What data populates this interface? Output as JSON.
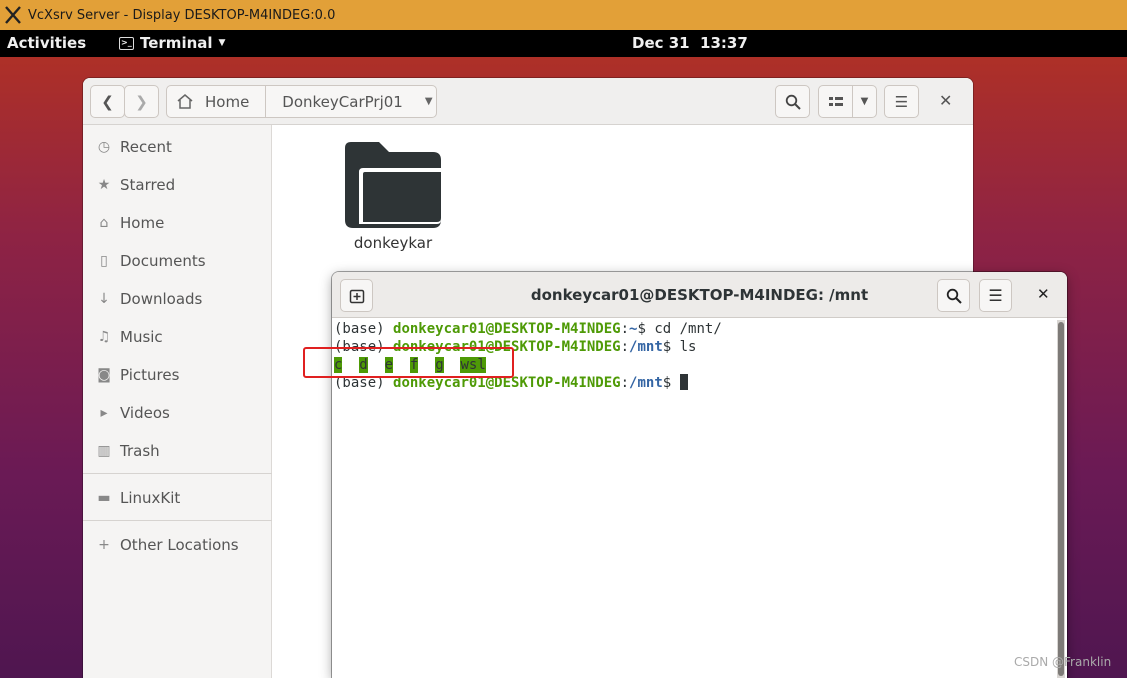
{
  "host": {
    "title": "VcXsrv Server - Display DESKTOP-M4INDEG:0.0"
  },
  "topbar": {
    "activities": "Activities",
    "app": "Terminal",
    "clock": "Dec 31  13:37"
  },
  "files": {
    "breadcrumb": {
      "home": "Home",
      "current": "DonkeyCarPrj01"
    },
    "sidebar": {
      "items": [
        {
          "label": "Recent",
          "icon": "clock-icon"
        },
        {
          "label": "Starred",
          "icon": "star-icon"
        },
        {
          "label": "Home",
          "icon": "home-icon"
        },
        {
          "label": "Documents",
          "icon": "document-icon"
        },
        {
          "label": "Downloads",
          "icon": "download-icon"
        },
        {
          "label": "Music",
          "icon": "music-icon"
        },
        {
          "label": "Pictures",
          "icon": "camera-icon"
        },
        {
          "label": "Videos",
          "icon": "video-icon"
        },
        {
          "label": "Trash",
          "icon": "trash-icon"
        }
      ],
      "devices": [
        {
          "label": "LinuxKit",
          "icon": "drive-icon"
        }
      ],
      "other": {
        "label": "Other Locations",
        "icon": "plus-icon"
      }
    },
    "content": {
      "folder_name": "donkeykar"
    }
  },
  "terminal": {
    "title": "donkeycar01@DESKTOP-M4INDEG: /mnt",
    "lines": {
      "l1_prefix": "(base) ",
      "l1_user": "donkeycar01@DESKTOP-M4INDEG",
      "l1_colon": ":",
      "l1_path": "~",
      "l1_cmd": "$ cd /mnt/",
      "l2_prefix": "(base) ",
      "l2_user": "donkeycar01@DESKTOP-M4INDEG",
      "l2_colon": ":",
      "l2_path": "/mnt",
      "l2_cmd": "$ ls",
      "l3_dirs": [
        "c",
        "d",
        "e",
        "f",
        "g"
      ],
      "l3_wsl": "wsl",
      "l4_prefix": "(base) ",
      "l4_user": "donkeycar01@DESKTOP-M4INDEG",
      "l4_colon": ":",
      "l4_path": "/mnt",
      "l4_cmd": "$ "
    }
  },
  "watermark": "CSDN @Franklin",
  "colors": {
    "prompt_green": "#4e9a06",
    "path_blue": "#3465a4",
    "annotation_red": "#e02020",
    "host_bar": "#e2a038"
  }
}
